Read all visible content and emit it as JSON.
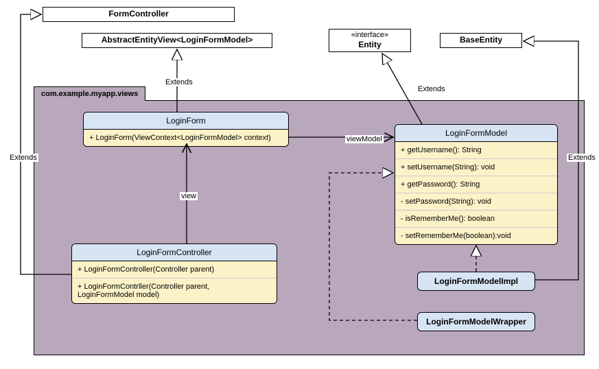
{
  "external": {
    "formController": "FormController",
    "abstractEntityView": "AbstractEntityView<LoginFormModel>",
    "entityStereo": "«interface»",
    "entityName": "Entity",
    "baseEntity": "BaseEntity"
  },
  "pkg": {
    "name": "com.example.myapp.views"
  },
  "classes": {
    "loginForm": {
      "name": "LoginForm",
      "members": [
        "+ LoginForm(ViewContext<LoginFormModel> context)"
      ]
    },
    "loginFormController": {
      "name": "LoginFormController",
      "members": [
        "+ LoginFormController(Controller parent)",
        "+ LoginFormContrller(Controller parent,\n       LoginFormModel model)"
      ]
    },
    "loginFormModel": {
      "name": "LoginFormModel",
      "members": [
        "+ getUsername(): String",
        "+ setUsername(String): void",
        "+ getPassword(): String",
        "- setPassword(String): void",
        "- isRememberMe(): boolean",
        "- setRememberMe(boolean):void"
      ]
    },
    "loginFormModelImpl": "LoginFormModelImpl",
    "loginFormModelWrapper": "LoginFormModelWrapper"
  },
  "labels": {
    "extends": "Extends",
    "view": "view",
    "viewModel": "viewModel"
  },
  "chart_data": {
    "type": "uml-class-diagram",
    "package": "com.example.myapp.views",
    "external_classifiers": [
      {
        "name": "FormController",
        "kind": "class"
      },
      {
        "name": "AbstractEntityView<LoginFormModel>",
        "kind": "class"
      },
      {
        "name": "Entity",
        "kind": "interface"
      },
      {
        "name": "BaseEntity",
        "kind": "class"
      }
    ],
    "classifiers": [
      {
        "name": "LoginForm",
        "members": [
          {
            "visibility": "+",
            "signature": "LoginForm(ViewContext<LoginFormModel> context)"
          }
        ]
      },
      {
        "name": "LoginFormController",
        "members": [
          {
            "visibility": "+",
            "signature": "LoginFormController(Controller parent)"
          },
          {
            "visibility": "+",
            "signature": "LoginFormContrller(Controller parent, LoginFormModel model)"
          }
        ]
      },
      {
        "name": "LoginFormModel",
        "members": [
          {
            "visibility": "+",
            "signature": "getUsername(): String"
          },
          {
            "visibility": "+",
            "signature": "setUsername(String): void"
          },
          {
            "visibility": "+",
            "signature": "getPassword(): String"
          },
          {
            "visibility": "-",
            "signature": "setPassword(String): void"
          },
          {
            "visibility": "-",
            "signature": "isRememberMe(): boolean"
          },
          {
            "visibility": "-",
            "signature": "setRememberMe(boolean): void"
          }
        ]
      },
      {
        "name": "LoginFormModelImpl",
        "members": []
      },
      {
        "name": "LoginFormModelWrapper",
        "members": []
      }
    ],
    "relationships": [
      {
        "from": "LoginForm",
        "to": "AbstractEntityView<LoginFormModel>",
        "kind": "generalization",
        "label": "Extends"
      },
      {
        "from": "LoginFormController",
        "to": "FormController",
        "kind": "generalization",
        "label": "Extends"
      },
      {
        "from": "LoginFormModel",
        "to": "Entity",
        "kind": "generalization",
        "label": "Extends"
      },
      {
        "from": "LoginFormModelImpl",
        "to": "BaseEntity",
        "kind": "generalization",
        "label": "Extends"
      },
      {
        "from": "LoginFormController",
        "to": "LoginForm",
        "kind": "association",
        "label": "view"
      },
      {
        "from": "LoginForm",
        "to": "LoginFormModel",
        "kind": "association",
        "label": "viewModel"
      },
      {
        "from": "LoginFormModelImpl",
        "to": "LoginFormModel",
        "kind": "realization"
      },
      {
        "from": "LoginFormModelWrapper",
        "to": "LoginFormModel",
        "kind": "realization"
      }
    ]
  }
}
